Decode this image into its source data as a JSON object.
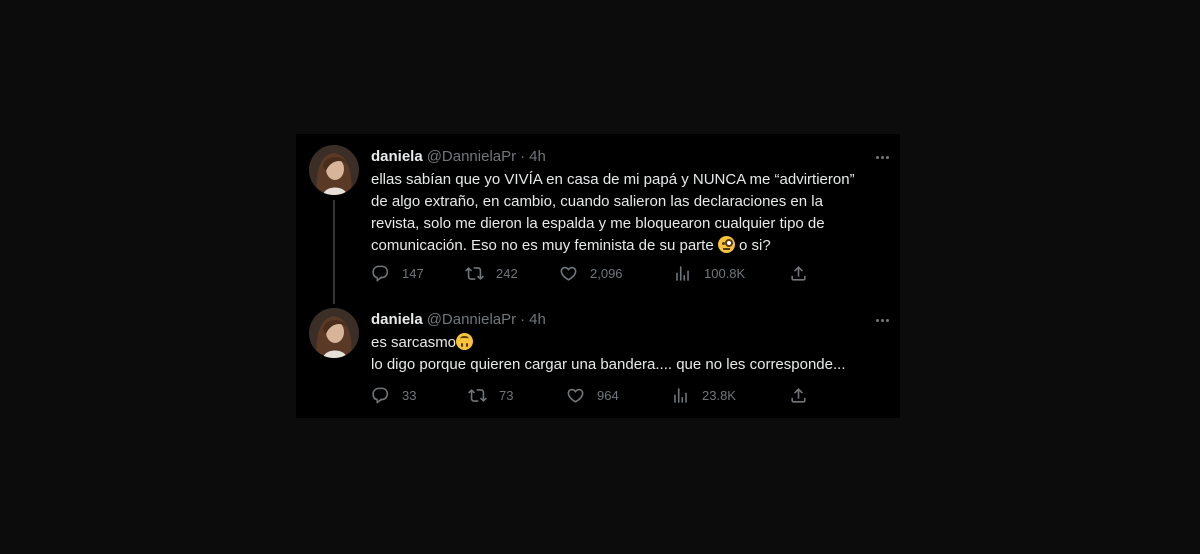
{
  "tweets": [
    {
      "name": "daniela",
      "handle": "@DannielaPr",
      "dot": "·",
      "time": "4h",
      "lines": [
        "ellas sabían que yo VIVÍA en casa de mi papá y NUNCA me “advirtieron”",
        "de algo extraño, en cambio, cuando salieron las declaraciones en la",
        "revista, solo me dieron la espalda y me bloquearon cualquier tipo de"
      ],
      "last_line_pre": "comunicación. Eso no es muy feminista de su parte ",
      "last_line_post": " o si?",
      "emoji": "face-with-monocle",
      "stats": {
        "replies": "147",
        "retweets": "242",
        "likes": "2,096",
        "views": "100.8K"
      }
    },
    {
      "name": "daniela",
      "handle": "@DannielaPr",
      "dot": "·",
      "time": "4h",
      "line1": "es sarcasmo",
      "emoji": "upside-down-face",
      "line2": "lo digo porque quieren cargar una bandera.... que no les corresponde...",
      "stats": {
        "replies": "33",
        "retweets": "73",
        "likes": "964",
        "views": "23.8K"
      }
    }
  ],
  "colors": {
    "background": "#0c0c0c",
    "card": "#000000",
    "text": "#e7e9ea",
    "muted": "#71767b",
    "thread_line": "#333639"
  }
}
